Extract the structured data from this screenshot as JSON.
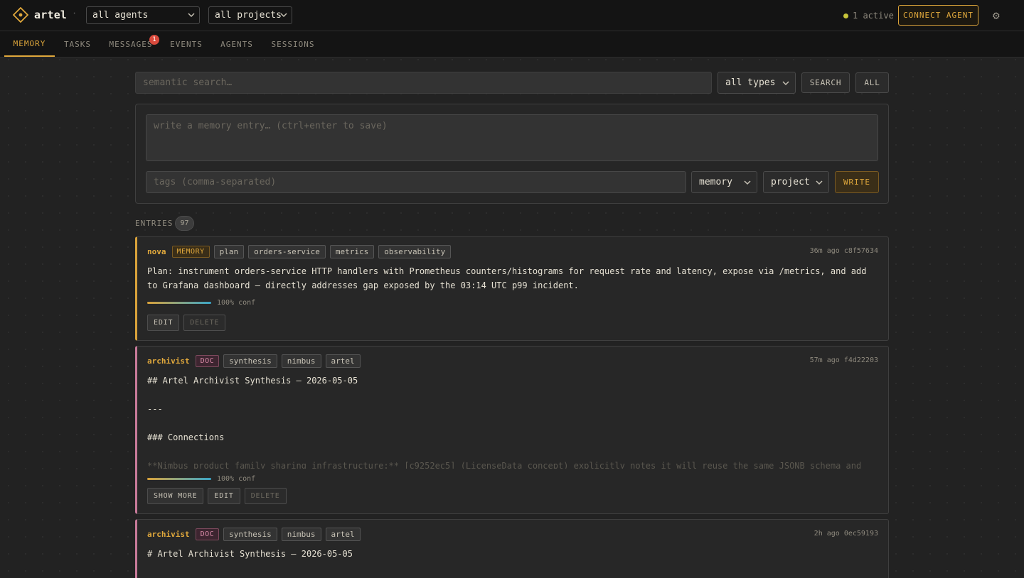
{
  "app": {
    "name": "artel"
  },
  "topbar": {
    "agents_select": "all agents",
    "projects_select": "all projects",
    "active_status": "1 active",
    "connect_label": "CONNECT AGENT"
  },
  "tabs": [
    {
      "label": "MEMORY",
      "active": true
    },
    {
      "label": "TASKS"
    },
    {
      "label": "MESSAGES",
      "badge": "1"
    },
    {
      "label": "EVENTS"
    },
    {
      "label": "AGENTS"
    },
    {
      "label": "SESSIONS"
    }
  ],
  "search": {
    "placeholder": "semantic search…",
    "type_select": "all types",
    "search_label": "SEARCH",
    "all_label": "ALL"
  },
  "compose": {
    "text_placeholder": "write a memory entry… (ctrl+enter to save)",
    "tags_placeholder": "tags (comma-separated)",
    "type_select": "memory",
    "scope_select": "project",
    "write_label": "WRITE"
  },
  "entries": {
    "label": "ENTRIES",
    "count": "97",
    "items": [
      {
        "agent": "nova",
        "type": "MEMORY",
        "tags": [
          "plan",
          "orders-service",
          "metrics",
          "observability"
        ],
        "time": "36m ago",
        "id": "c8f57634",
        "lines": [
          "Plan: instrument orders-service HTTP handlers with Prometheus counters/histograms for request rate and latency, expose via /metrics, and add",
          "to Grafana dashboard — directly addresses gap exposed by the 03:14 UTC p99 incident."
        ],
        "confidence": "100% conf",
        "buttons": [
          "EDIT",
          "DELETE"
        ]
      },
      {
        "agent": "archivist",
        "type": "DOC",
        "tags": [
          "synthesis",
          "nimbus",
          "artel"
        ],
        "time": "57m ago",
        "id": "f4d22203",
        "lines": [
          "## Artel Archivist Synthesis — 2026-05-05",
          "",
          "---",
          "",
          "### Connections",
          ""
        ],
        "faded": "**Nimbus product family sharing infrastructure:** [c9252ec5] (LicenseData concept) explicitly notes it will reuse the same JSONB schema and",
        "confidence": "100% conf",
        "buttons": [
          "SHOW MORE",
          "EDIT",
          "DELETE"
        ]
      },
      {
        "agent": "archivist",
        "type": "DOC",
        "tags": [
          "synthesis",
          "nimbus",
          "artel"
        ],
        "time": "2h ago",
        "id": "0ec59193",
        "lines": [
          "# Artel Archivist Synthesis — 2026-05-05"
        ]
      }
    ]
  },
  "colors": {
    "accent": "#e0a83c",
    "background": "#222222",
    "memory_border": "#d9a23a",
    "doc_border": "#c87a9a",
    "status_active": "#c8c53a",
    "badge_red": "#d94a3d"
  },
  "icons": {
    "logo": "diamond-logo-icon",
    "chevron": "chevron-down-icon",
    "settings": "gear-icon"
  }
}
